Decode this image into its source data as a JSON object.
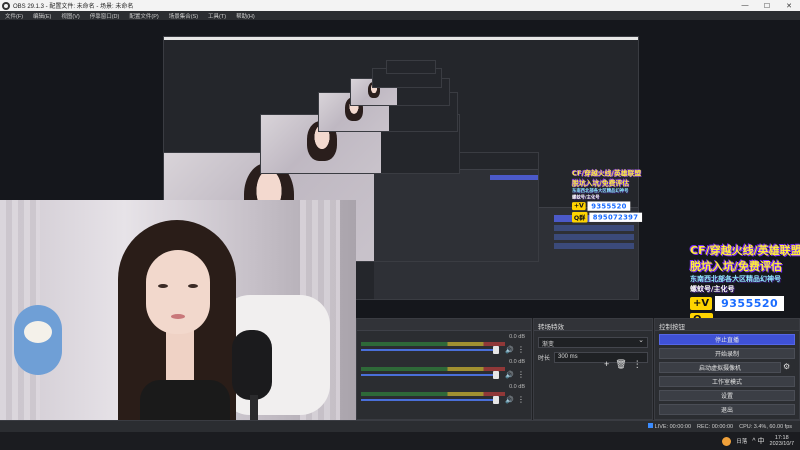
{
  "window": {
    "title": "OBS 29.1.3 - 配置文件: 未命名 - 场景: 未命名",
    "controls": [
      "—",
      "☐",
      "✕"
    ]
  },
  "menu": [
    "文件(F)",
    "编辑(E)",
    "视图(V)",
    "停靠窗口(D)",
    "配置文件(P)",
    "场景集合(S)",
    "工具(T)",
    "帮助(H)"
  ],
  "overlay": {
    "line1": "CF/穿越火线/英雄联盟",
    "line2": "脱坑入坑/免费评估",
    "line3": "东南西北部各大区精品幻神号",
    "line4": "螺蚊号/主化号",
    "qq_tag": "+V",
    "qq_value": "9355520",
    "group_tag": "Q群",
    "group_value": "895072397"
  },
  "mixer": {
    "title": "",
    "channels": [
      {
        "db": "0.0 dB"
      },
      {
        "db": "0.0 dB"
      },
      {
        "db": "0.0 dB"
      }
    ]
  },
  "transitions": {
    "title": "转场特效",
    "selected": "渐变",
    "duration_label": "时长",
    "duration_value": "300 ms"
  },
  "controls": {
    "title": "控制按钮",
    "buttons": [
      "停止直播",
      "开始录制",
      "启动虚拟摄像机",
      "工作室模式",
      "设置",
      "退出"
    ]
  },
  "status": {
    "live": "LIVE: 00:00:00",
    "rec": "REC: 00:00:00",
    "cpu": "CPU: 3.4%, 60.00 fps"
  },
  "taskbar": {
    "weather": "日落",
    "time": "17:18",
    "date": "2023/10/7",
    "tray": "^ 中"
  },
  "colors": {
    "accent": "#3f51d6",
    "overlay_yellow": "#ffef3a",
    "overlay_outline": "#7a2cff"
  }
}
